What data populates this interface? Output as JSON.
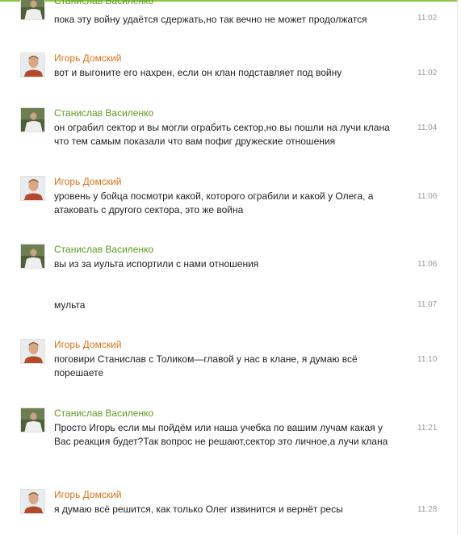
{
  "colors": {
    "accent_border": "#8fc63f",
    "stanislav_name": "#5b9a1f",
    "igor_name": "#d9741c",
    "text": "#222222",
    "time": "#9a9a9a"
  },
  "messages": [
    {
      "author": "Станислав Василенко",
      "avatar_icon": "user-photo-icon",
      "text": "пока эту войну удаётся сдержать,но так вечно не может продолжатся",
      "time": "11:02"
    },
    {
      "author": "Игорь Домский",
      "avatar_icon": "user-photo-icon",
      "text": "вот и выгоните его нахрен, если он клан подставляет под войну",
      "time": "11:02"
    },
    {
      "author": "Станислав Василенко",
      "avatar_icon": "user-photo-icon",
      "text": "он ограбил сектор и вы могли ограбить сектор,но вы пошли на лучи клана что тем самым показали что вам пофиг дружеские отношения",
      "time": "11:04"
    },
    {
      "author": "Игорь Домский",
      "avatar_icon": "user-photo-icon",
      "text": "уровень у бойца посмотри какой, которого ограбили и какой у Олега, а атаковать с другого сектора, это же война",
      "time": "11:06"
    },
    {
      "author": "Станислав Василенко",
      "avatar_icon": "user-photo-icon",
      "text": "вы из за иульта испортили с нами отношения",
      "time": "11:06"
    },
    {
      "text": "мульта",
      "time": "11:07"
    },
    {
      "author": "Игорь Домский",
      "avatar_icon": "user-photo-icon",
      "text": "поговири Станислав с Толиком—главой у нас в клане, я думаю всё порешаете",
      "time": "11:10"
    },
    {
      "author": "Станислав Василенко",
      "avatar_icon": "user-photo-icon",
      "text": "Просто Игорь если мы пойдём или наша учебка по вашим лучам какая у Вас реакция будет?Так вопрос не решают,сектор это личное,а лучи клана",
      "time": "11:21"
    },
    {
      "author": "Игорь Домский",
      "avatar_icon": "user-photo-icon",
      "text": "я думаю всё решится, как только Олег извинится и вернёт ресы",
      "time": "11:28"
    }
  ]
}
